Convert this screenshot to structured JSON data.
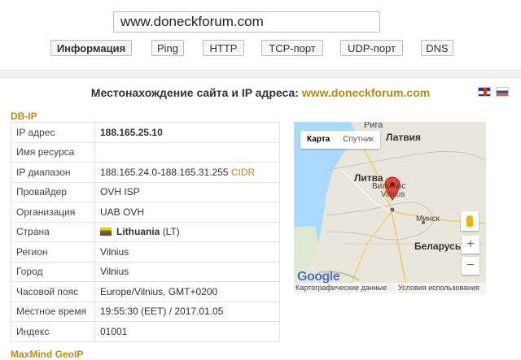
{
  "search": {
    "value": "www.doneckforum.com"
  },
  "tabs": [
    "Информация",
    "Ping",
    "HTTP",
    "TCP-порт",
    "UDP-порт",
    "DNS"
  ],
  "section": {
    "title": "Местонахождение сайта и IP адреса:",
    "domain": "www.doneckforum.com"
  },
  "dbip": {
    "label": "DB-IP",
    "rows": [
      {
        "key": "IP адрес",
        "value": "188.165.25.10"
      },
      {
        "key": "Имя ресурса",
        "value": ""
      },
      {
        "key": "IP диапазон",
        "value": "188.165.24.0-188.165.31.255",
        "link": "CIDR"
      },
      {
        "key": "Провайдер",
        "value": "OVH ISP"
      },
      {
        "key": "Организация",
        "value": "UAB OVH"
      },
      {
        "key": "Страна",
        "value": "Lithuania",
        "suffix": "(LT)"
      },
      {
        "key": "Регион",
        "value": "Vilnius"
      },
      {
        "key": "Город",
        "value": "Vilnius"
      },
      {
        "key": "Часовой пояс",
        "value": "Europe/Vilnius, GMT+0200"
      },
      {
        "key": "Местное время",
        "value": "19:55:30 (EET) / 2017.01.05"
      },
      {
        "key": "Индекс",
        "value": "01001"
      }
    ]
  },
  "maxmind": {
    "label": "MaxMind GeoIP"
  },
  "map": {
    "type_map": "Карта",
    "type_sat": "Спутник",
    "labels": {
      "riga": "Рига",
      "latvia": "Латвия",
      "lithuania": "Литва",
      "vilnius_ru": "Вильнюс",
      "vilnius_en": "Vilnius",
      "minsk": "Минск",
      "belarus": "Беларусь"
    },
    "zoom_in": "+",
    "zoom_out": "−",
    "google": "Google",
    "footer_data": "Картографические данные",
    "footer_terms": "Условия использования"
  },
  "colors": {
    "accent": "#b58b1c",
    "marker": "#e8453c"
  }
}
